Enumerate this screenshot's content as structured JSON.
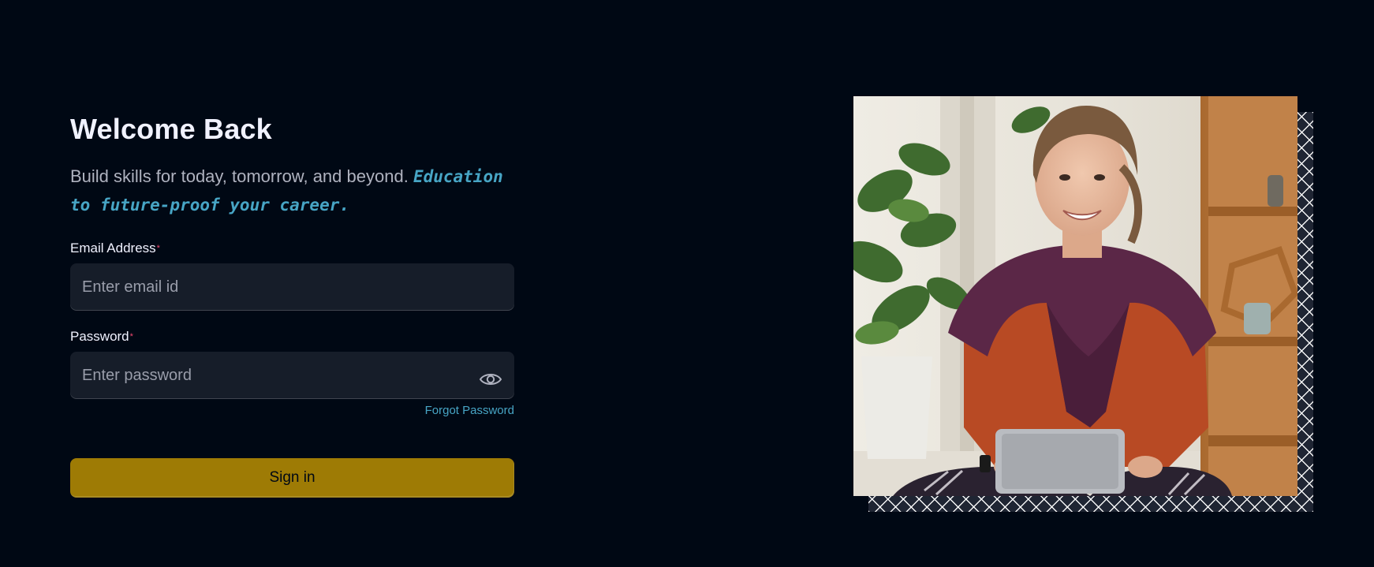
{
  "heading": "Welcome Back",
  "subtitle": {
    "text": "Build skills for today, tomorrow, and beyond.",
    "accent": "Education to future-proof your career."
  },
  "email": {
    "label": "Email Address",
    "required_mark": "*",
    "placeholder": "Enter email id",
    "value": ""
  },
  "password": {
    "label": "Password",
    "required_mark": "*",
    "placeholder": "Enter password",
    "value": "",
    "toggle_icon": "eye-icon"
  },
  "forgot_password": "Forgot Password",
  "signin_label": "Sign in",
  "colors": {
    "background": "#000814",
    "heading": "#f1f2ff",
    "subtitle": "#afb2bf",
    "accent": "#47a5c5",
    "input_bg": "#161d29",
    "required": "#ef476f",
    "button": "#9e7b05",
    "button_text": "#000814"
  },
  "image": {
    "subject": "student-with-tablet-photo",
    "pattern": "crosshatch-frame"
  }
}
